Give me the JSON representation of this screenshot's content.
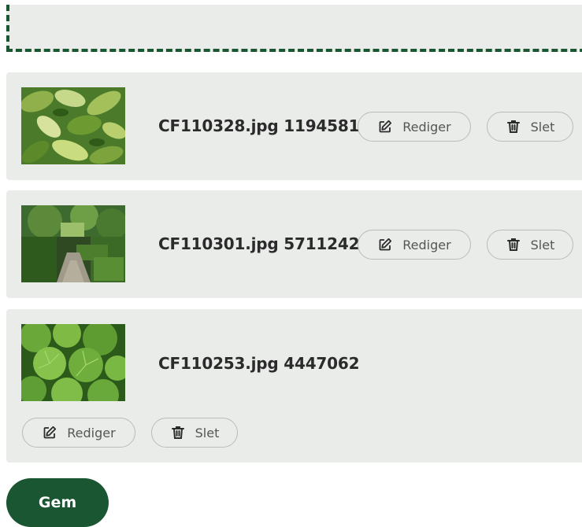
{
  "files": [
    {
      "name": "CF110328.jpg 1194581",
      "edit_label": "Rediger",
      "delete_label": "Slet"
    },
    {
      "name": "CF110301.jpg 5711242",
      "edit_label": "Rediger",
      "delete_label": "Slet"
    },
    {
      "name": "CF110253.jpg 4447062",
      "edit_label": "Rediger",
      "delete_label": "Slet"
    }
  ],
  "save_label": "Gem",
  "colors": {
    "primary": "#1a5632",
    "card_background": "#eaecea",
    "pill_border": "#b9bcb9",
    "text": "#2b2b2b"
  },
  "icons": {
    "edit": "pencil-square-icon",
    "delete": "trash-icon"
  }
}
